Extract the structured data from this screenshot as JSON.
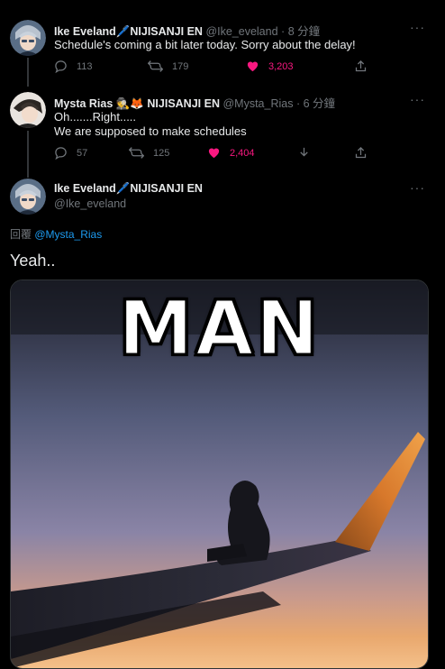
{
  "tweets": [
    {
      "name": "Ike Eveland",
      "name_suffix": "🖊️NIJISANJI EN",
      "handle": "@Ike_eveland",
      "time": "8 分鐘",
      "text": "Schedule's coming a bit later today. Sorry about the delay!",
      "replies": "113",
      "retweets": "179",
      "likes": "3,203"
    },
    {
      "name": "Mysta Rias",
      "name_suffix": "🕵️🦊 NIJISANJI EN",
      "handle": "@Mysta_Rias",
      "time": "6 分鐘",
      "text_lines": [
        "Oh.......Right.....",
        "We are supposed to make schedules"
      ],
      "replies": "57",
      "retweets": "125",
      "likes": "2,404"
    }
  ],
  "main_tweet": {
    "name": "Ike Eveland",
    "name_suffix": "🖊️NIJISANJI EN",
    "handle": "@Ike_eveland",
    "reply_label": "回覆",
    "reply_to": "@Mysta_Rias",
    "text": "Yeah..",
    "image_caption": "MAN"
  },
  "dot_sep": "·",
  "more_label": "···",
  "colors": {
    "background": "#000000",
    "like_pink": "#f91880",
    "link_blue": "#1d9bf0",
    "muted": "#71767b"
  }
}
